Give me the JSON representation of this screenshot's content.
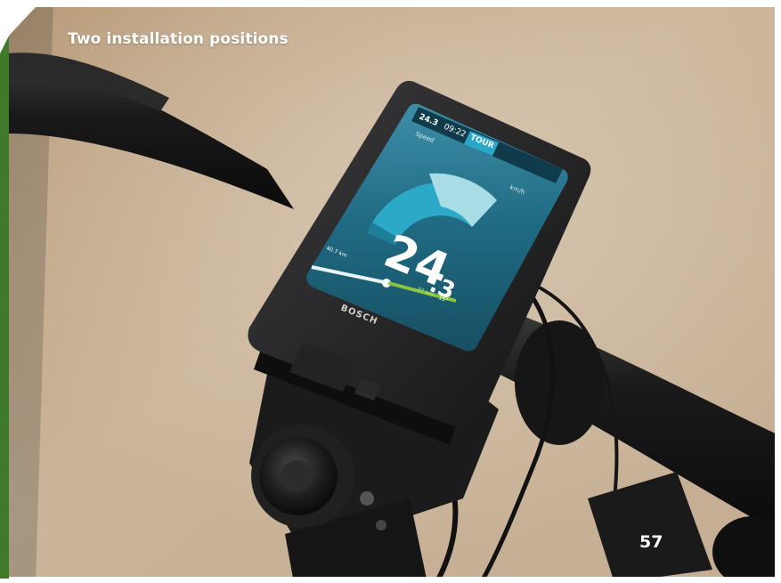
{
  "heading": "Two installation positions",
  "page_number": "57",
  "display": {
    "brand": "BOSCH",
    "speed_value": "24",
    "speed_decimal": ".3",
    "speed_unit": "km/h",
    "speed_label": "Speed",
    "mode": "TOUR",
    "status_left": "24.3",
    "clock": "09:22",
    "distance_left": "40.7 km",
    "distance_right": "37 km",
    "temperature": "15°"
  },
  "colors": {
    "frame": "#ffffff",
    "sidebar_green": "#3e7a2a",
    "screen_bg": "#1f6e86",
    "gauge_teal": "#29a8c6"
  }
}
